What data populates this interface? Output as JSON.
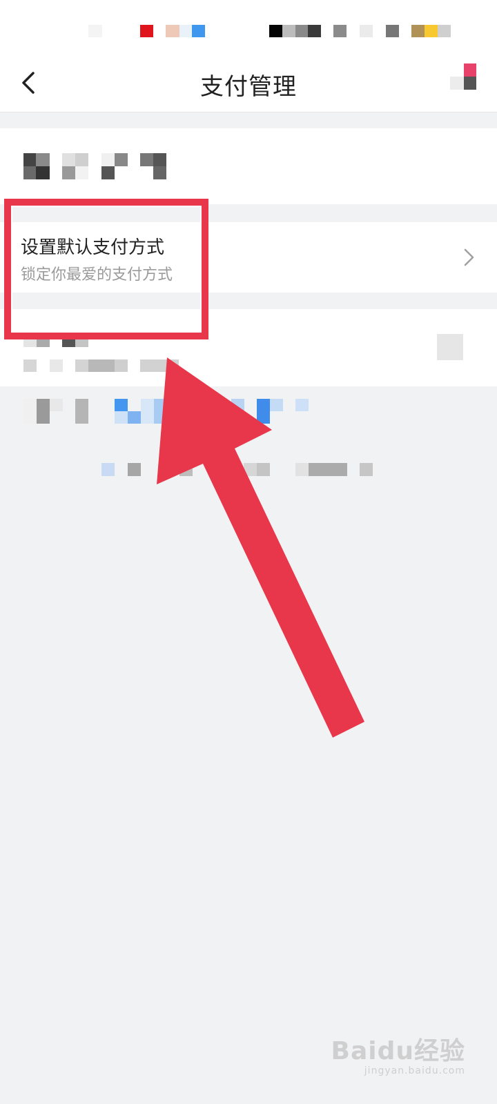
{
  "navbar": {
    "title": "支付管理",
    "back_icon": "chevron-left-icon",
    "menu_icon": "more-icon"
  },
  "setting_default_payment": {
    "title": "设置默认支付方式",
    "subtitle": "锁定你最爱的支付方式",
    "chevron_icon": "chevron-right-icon"
  },
  "annotation": {
    "highlight_color": "#e8374b",
    "arrow_color": "#e8374b"
  },
  "watermark": {
    "brand": "Baidu经验",
    "url": "jingyan.baidu.com"
  }
}
